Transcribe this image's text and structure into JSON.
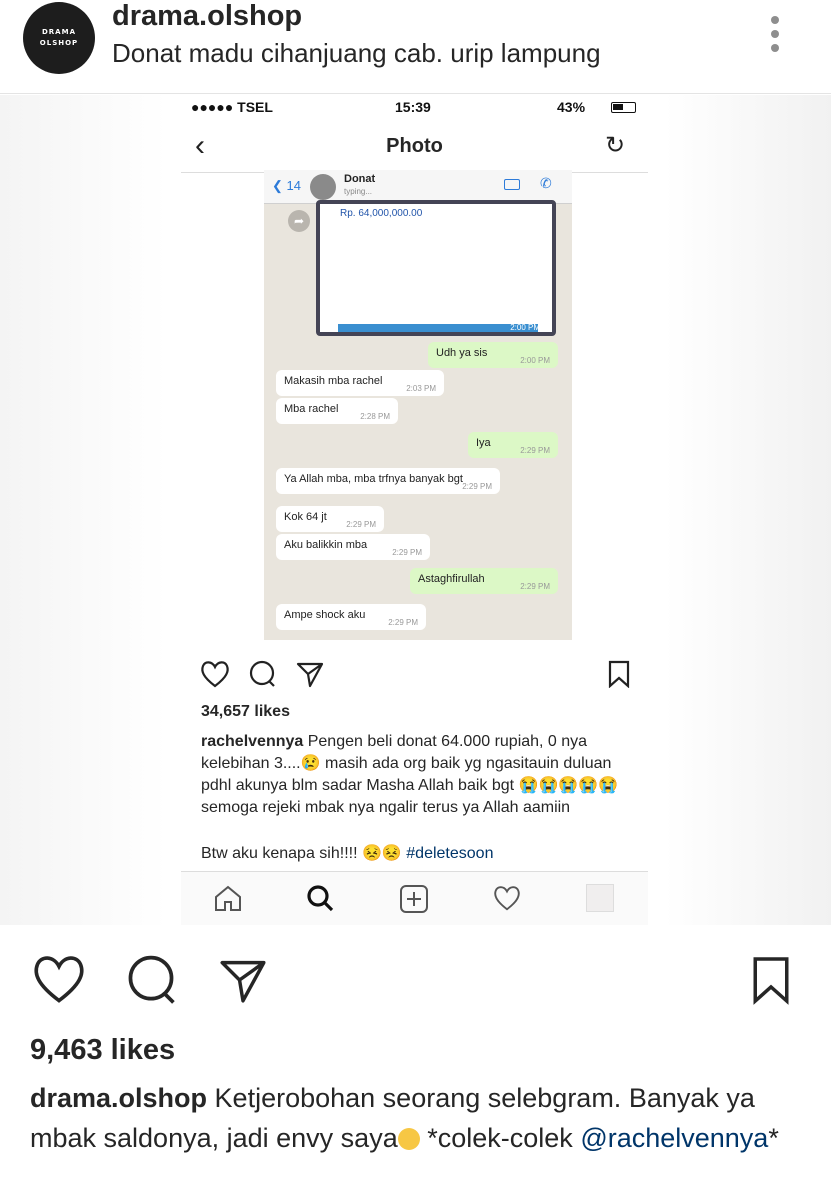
{
  "post": {
    "avatar_text_1": "DRAMA",
    "avatar_text_2": "OLSHOP",
    "username": "drama.olshop",
    "location": "Donat madu cihanjuang cab. urip lampung"
  },
  "embedded": {
    "status_bar": {
      "carrier": "●●●●● TSEL",
      "time": "15:39",
      "battery": "43%"
    },
    "nav_title": "Photo",
    "chat": {
      "back_count": "14",
      "contact_name": "Donat",
      "contact_status": "typing...",
      "image_amount": "Rp. 64,000,000.00",
      "image_time": "2:00 PM",
      "messages": [
        {
          "dir": "out",
          "text": "Udh ya sis",
          "time": "2:00 PM"
        },
        {
          "dir": "in",
          "text": "Makasih mba rachel",
          "time": "2:03 PM"
        },
        {
          "dir": "in",
          "text": "Mba rachel",
          "time": "2:28 PM"
        },
        {
          "dir": "out",
          "text": "Iya",
          "time": "2:29 PM"
        },
        {
          "dir": "in",
          "text": "Ya Allah mba, mba trfnya banyak bgt",
          "time": "2:29 PM"
        },
        {
          "dir": "in",
          "text": "Kok 64 jt",
          "time": "2:29 PM"
        },
        {
          "dir": "in",
          "text": "Aku balikkin mba",
          "time": "2:29 PM"
        },
        {
          "dir": "out",
          "text": "Astaghfirullah",
          "time": "2:29 PM"
        },
        {
          "dir": "in",
          "text": "Ampe shock aku",
          "time": "2:29 PM"
        }
      ]
    },
    "likes": "34,657 likes",
    "caption_user": "rachelvennya",
    "caption_text": "Pengen beli donat 64.000 rupiah, 0 nya kelebihan 3....😢 masih ada org baik yg ngasitauin duluan pdhl akunya blm sadar Masha Allah baik bgt 😭😭😭😭😭 semoga rejeki mbak nya ngalir terus ya Allah aamiin",
    "caption_line2": "Btw aku kenapa sih!!!! 😣😣",
    "hashtag": "#deletesoon"
  },
  "outer": {
    "likes": "9,463 likes",
    "caption_user": "drama.olshop",
    "caption_text": "Ketjerobohan seorang selebgram. Banyak ya mbak saldonya, jadi envy saya",
    "caption_after_emoji": "*colek-colek",
    "mention": "@rachelvennya",
    "caption_end": "*"
  },
  "colors": {
    "link": "#003569",
    "outgoing_bubble": "#dcf8c6",
    "chat_bg": "#e9e5dd",
    "chat_accent": "#2d7bd9"
  },
  "icons": [
    "heart-icon",
    "comment-icon",
    "share-icon",
    "bookmark-icon",
    "home-icon",
    "search-icon",
    "add-icon",
    "activity-icon",
    "more-icon"
  ]
}
